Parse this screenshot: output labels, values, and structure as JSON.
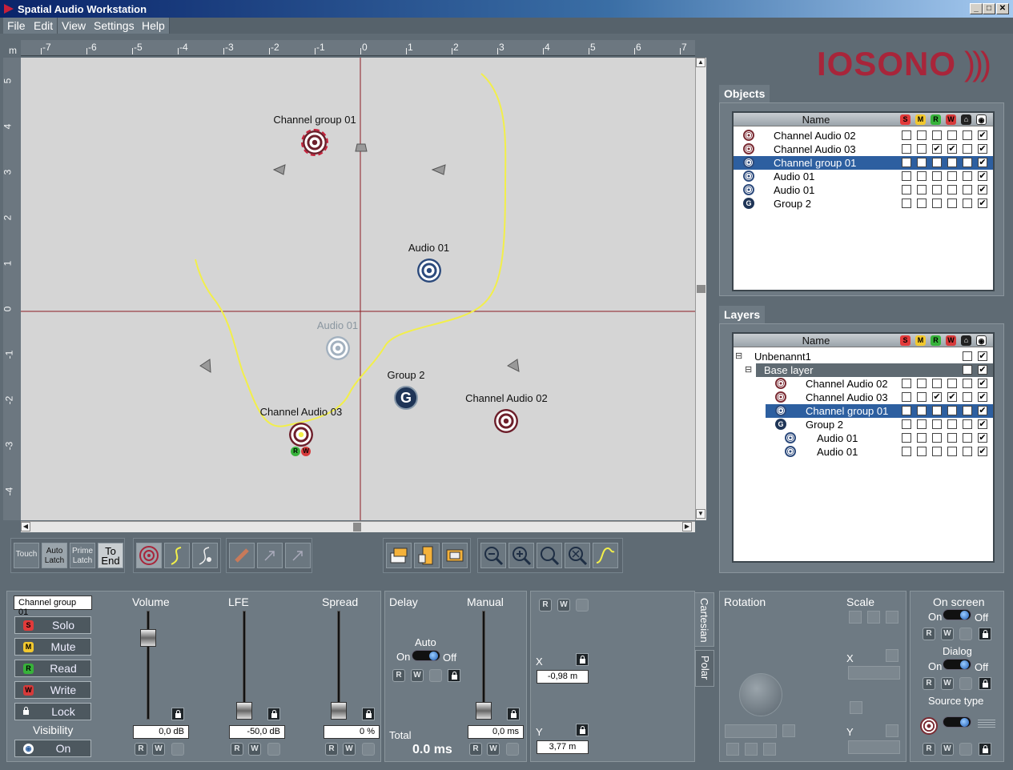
{
  "window": {
    "title": "Spatial Audio Workstation"
  },
  "menu": [
    "File",
    "Edit",
    "View",
    "Settings",
    "Help"
  ],
  "ruler": {
    "unit": "m",
    "x_ticks": [
      "-7",
      "-6",
      "-5",
      "-4",
      "-3",
      "-2",
      "-1",
      "0",
      "1",
      "2",
      "3",
      "4",
      "5",
      "6",
      "7"
    ],
    "y_ticks": [
      "5",
      "4",
      "3",
      "2",
      "1",
      "0",
      "-1",
      "-2",
      "-3",
      "-4"
    ]
  },
  "canvas": {
    "objects": [
      {
        "label": "Channel group 01",
        "type": "channel-group",
        "x": -1.0,
        "y": 3.7
      },
      {
        "label": "Audio 01",
        "type": "audio",
        "x": 1.5,
        "y": 0.9
      },
      {
        "label": "Audio 01",
        "type": "audio-ghost",
        "x": -0.5,
        "y": -0.8
      },
      {
        "label": "Group 2",
        "type": "group",
        "x": 1.0,
        "y": -1.9
      },
      {
        "label": "Channel Audio 03",
        "type": "channel-audio",
        "x": -1.3,
        "y": -2.7
      },
      {
        "label": "Channel Audio 02",
        "type": "channel-audio",
        "x": 3.2,
        "y": -2.4
      }
    ],
    "badges": [
      "R",
      "W"
    ]
  },
  "toolbar": {
    "touch": "Touch",
    "auto_latch": "Auto Latch",
    "prime_latch": "Prime Latch",
    "to_end": "To End"
  },
  "logo": "IOSONO",
  "objects_panel": {
    "title": "Objects",
    "columns": [
      "Name",
      "S",
      "M",
      "R",
      "W"
    ],
    "rows": [
      {
        "name": "Channel Audio 02",
        "icon": "red",
        "checks": [
          false,
          false,
          false,
          false,
          false,
          true
        ],
        "selected": false
      },
      {
        "name": "Channel Audio 03",
        "icon": "red",
        "checks": [
          false,
          false,
          true,
          true,
          false,
          true
        ],
        "selected": false
      },
      {
        "name": "Channel group 01",
        "icon": "blue",
        "checks": [
          false,
          false,
          false,
          false,
          false,
          true
        ],
        "selected": true
      },
      {
        "name": "Audio 01",
        "icon": "blue",
        "checks": [
          false,
          false,
          false,
          false,
          false,
          true
        ],
        "selected": false
      },
      {
        "name": "Audio 01",
        "icon": "blue",
        "checks": [
          false,
          false,
          false,
          false,
          false,
          true
        ],
        "selected": false
      },
      {
        "name": "Group 2",
        "icon": "group",
        "checks": [
          false,
          false,
          false,
          false,
          false,
          true
        ],
        "selected": false
      }
    ]
  },
  "layers_panel": {
    "title": "Layers",
    "columns": [
      "Name",
      "S",
      "M",
      "R",
      "W"
    ],
    "rows": [
      {
        "name": "Unbenannt1",
        "indent": 0,
        "icon": "none",
        "checks": [
          false,
          true
        ],
        "short": true
      },
      {
        "name": "Base layer",
        "indent": 1,
        "icon": "none",
        "checks": [
          false,
          true
        ],
        "short": true,
        "dark": true
      },
      {
        "name": "Channel Audio 02",
        "indent": 2,
        "icon": "red",
        "checks": [
          false,
          false,
          false,
          false,
          false,
          true
        ]
      },
      {
        "name": "Channel Audio 03",
        "indent": 2,
        "icon": "red",
        "checks": [
          false,
          false,
          true,
          true,
          false,
          true
        ]
      },
      {
        "name": "Channel group 01",
        "indent": 2,
        "icon": "blue",
        "checks": [
          false,
          false,
          false,
          false,
          false,
          true
        ],
        "selected": true
      },
      {
        "name": "Group 2",
        "indent": 2,
        "icon": "group",
        "checks": [
          false,
          false,
          false,
          false,
          false,
          true
        ]
      },
      {
        "name": "Audio 01",
        "indent": 3,
        "icon": "blue",
        "checks": [
          false,
          false,
          false,
          false,
          false,
          true
        ]
      },
      {
        "name": "Audio 01",
        "indent": 3,
        "icon": "blue",
        "checks": [
          false,
          false,
          false,
          false,
          false,
          true
        ]
      }
    ]
  },
  "channel": {
    "name": "Channel group 01",
    "solo": "Solo",
    "mute": "Mute",
    "read": "Read",
    "write": "Write",
    "lock": "Lock",
    "visibility_label": "Visibility",
    "visibility_value": "On",
    "icon_letters": {
      "solo": "S",
      "mute": "M",
      "read": "R",
      "write": "W"
    }
  },
  "faders": {
    "volume": {
      "label": "Volume",
      "value": "0,0 dB",
      "level": 0.75
    },
    "lfe": {
      "label": "LFE",
      "value": "-50,0 dB",
      "level": 0.08
    },
    "spread": {
      "label": "Spread",
      "value": "0 %",
      "level": 0.08
    }
  },
  "delay": {
    "label": "Delay",
    "manual_label": "Manual",
    "auto_label": "Auto",
    "on": "On",
    "off": "Off",
    "total_label": "Total",
    "total_value": "0.0 ms",
    "manual_value": "0,0 ms",
    "manual_level": 0.08
  },
  "position": {
    "tab_cartesian": "Cartesian",
    "tab_polar": "Polar",
    "x_label": "X",
    "x_value": "-0,98 m",
    "y_label": "Y",
    "y_value": "3,77 m"
  },
  "rotation": {
    "label": "Rotation",
    "scale_label": "Scale",
    "x_label": "X",
    "y_label": "Y"
  },
  "onscreen": {
    "label": "On screen",
    "on": "On",
    "off": "Off",
    "dialog_label": "Dialog",
    "source_type_label": "Source type"
  },
  "rw": {
    "r": "R",
    "w": "W"
  },
  "colors": {
    "accent": "#2d5fa0",
    "logo": "#a8253a",
    "solo": "#e23a3a",
    "mute": "#f2c82e",
    "read": "#37b23a",
    "write": "#d63a3a"
  }
}
